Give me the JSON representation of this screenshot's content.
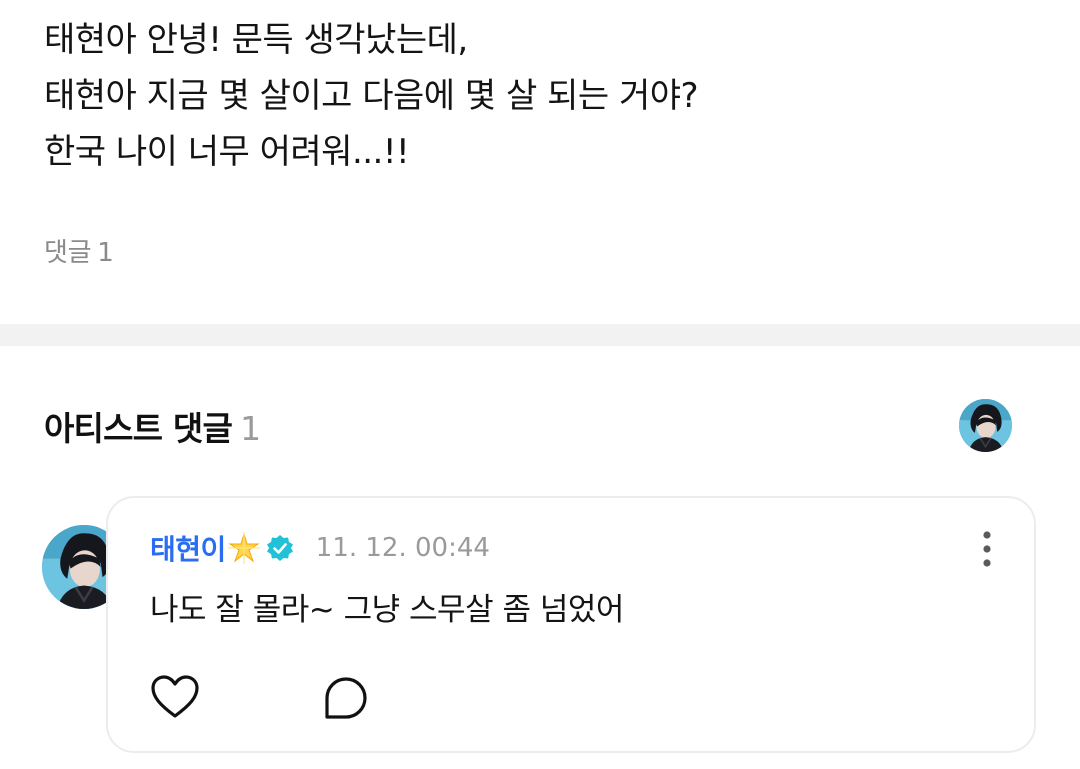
{
  "post": {
    "lines": [
      "태현아 안녕! 문득 생각났는데,",
      "태현아 지금 몇 살이고 다음에 몇 살 되는 거야?",
      "한국 나이 너무 어려워...!!"
    ],
    "comment_label": "댓글",
    "comment_count": "1"
  },
  "artist_comments": {
    "title": "아티스트 댓글",
    "count": "1",
    "comment": {
      "author": "태현이",
      "author_badge_icon": "sparkle-star-icon",
      "verified_icon": "verified-check-icon",
      "timestamp": "11. 12. 00:44",
      "text": "나도 잘 몰라~ 그냥 스무살 좀 넘었어"
    }
  },
  "colors": {
    "author_name": "#2a6df2",
    "verified_badge": "#21c2d8",
    "muted_text": "#9a9a9a",
    "divider": "#f2f2f2"
  }
}
